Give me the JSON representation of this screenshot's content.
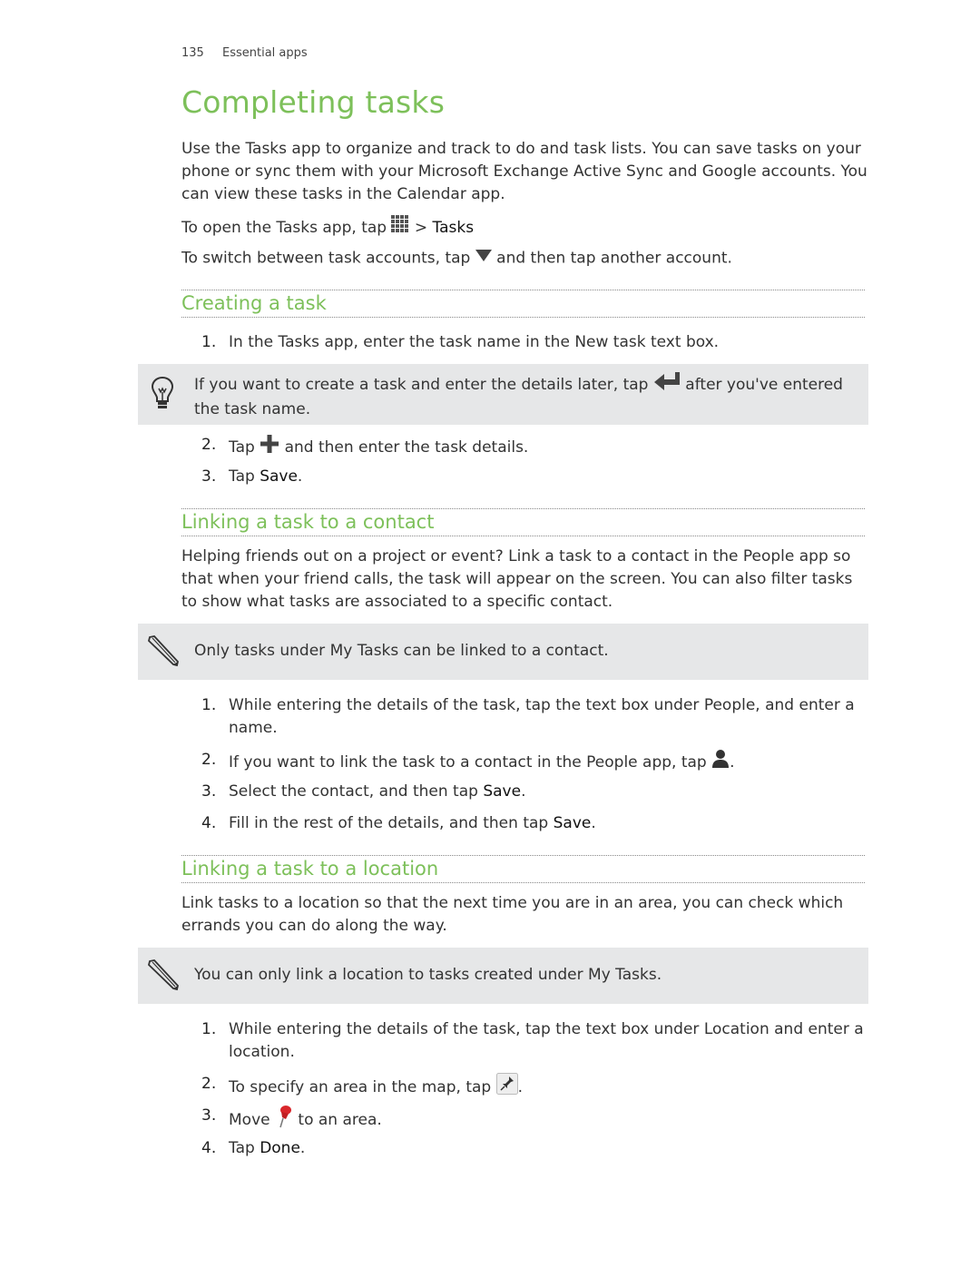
{
  "header": {
    "page_number": "135",
    "section": "Essential apps"
  },
  "title": "Completing tasks",
  "intro": "Use the Tasks app to organize and track to do and task lists. You can save tasks on your phone or sync them with your Microsoft Exchange Active Sync and Google accounts. You can view these tasks in the Calendar app.",
  "open_line": {
    "before": "To open the Tasks app, tap",
    "after": "> ",
    "target": "Tasks",
    "icon": "all-apps-grid-icon"
  },
  "switch_line": {
    "before": "To switch between task accounts, tap",
    "after": "and then tap another account.",
    "icon": "dropdown-triangle-icon"
  },
  "sections": {
    "creating": {
      "heading": "Creating a task",
      "step1": {
        "num": "1.",
        "text": "In the Tasks app, enter the task name in the New task text box."
      },
      "tip": {
        "before": "If you want to create a task and enter the details later, tap",
        "after": "after you've entered the task name.",
        "icon": "lightbulb-icon",
        "inline_icon": "enter-return-icon"
      },
      "step2": {
        "num": "2.",
        "before": "Tap",
        "after": "and then enter the task details.",
        "icon": "plus-icon"
      },
      "step3": {
        "num": "3.",
        "before": "Tap ",
        "strong": "Save",
        "after": "."
      }
    },
    "contact": {
      "heading": "Linking a task to a contact",
      "intro": "Helping friends out on a project or event? Link a task to a contact in the People app so that when your friend calls, the task will appear on the screen. You can also filter tasks to show what tasks are associated to a specific contact.",
      "note": "Only tasks under My Tasks can be linked to a contact.",
      "steps": [
        {
          "num": "1.",
          "text": "While entering the details of the task, tap the text box under People, and enter a name."
        },
        {
          "num": "2.",
          "before": "If you want to link the task to a contact in the People app, tap",
          "after": "."
        },
        {
          "num": "3.",
          "before": "Select the contact, and then tap ",
          "strong": "Save",
          "after": "."
        },
        {
          "num": "4.",
          "before": "Fill in the rest of the details, and then tap ",
          "strong": "Save",
          "after": "."
        }
      ]
    },
    "location": {
      "heading": "Linking a task to a location",
      "intro": "Link tasks to a location so that the next time you are in an area, you can check which errands you can do along the way.",
      "note": "You can only link a location to tasks created under My Tasks.",
      "steps": [
        {
          "num": "1.",
          "text": "While entering the details of the task, tap the text box under Location and enter a location."
        },
        {
          "num": "2.",
          "before": "To specify an area in the map, tap",
          "after": "."
        },
        {
          "num": "3.",
          "before": "Move",
          "after": "to an area."
        },
        {
          "num": "4.",
          "before": "Tap ",
          "strong": "Done",
          "after": "."
        }
      ]
    }
  },
  "colors": {
    "heading_green": "#7dc05a",
    "note_bg": "#e6e7e8",
    "body_text": "#333333"
  }
}
